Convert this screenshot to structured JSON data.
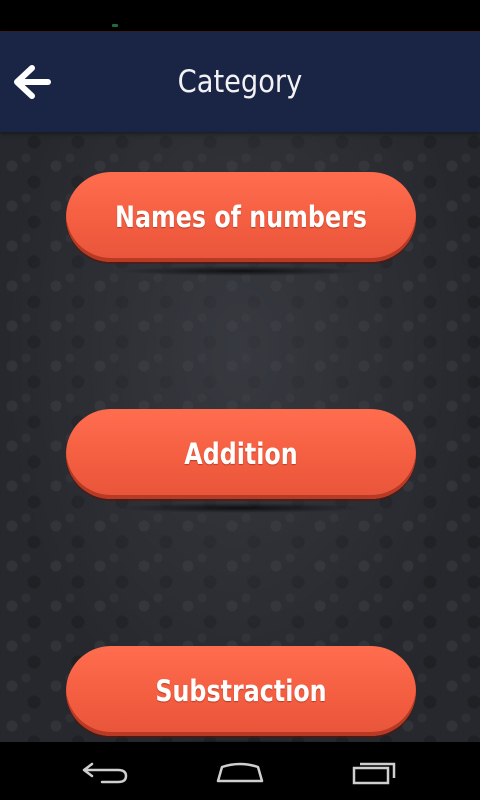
{
  "toolbar": {
    "title": "Category",
    "back_icon": "arrow-left-icon"
  },
  "categories": [
    {
      "label": "Names of numbers"
    },
    {
      "label": "Addition"
    },
    {
      "label": "Substraction"
    }
  ],
  "navigation": {
    "back_icon": "nav-back-icon",
    "home_icon": "nav-home-icon",
    "recents_icon": "nav-recents-icon"
  },
  "colors": {
    "toolbar": "#1a2444",
    "button": "#f45e41",
    "background": "#26282d"
  }
}
